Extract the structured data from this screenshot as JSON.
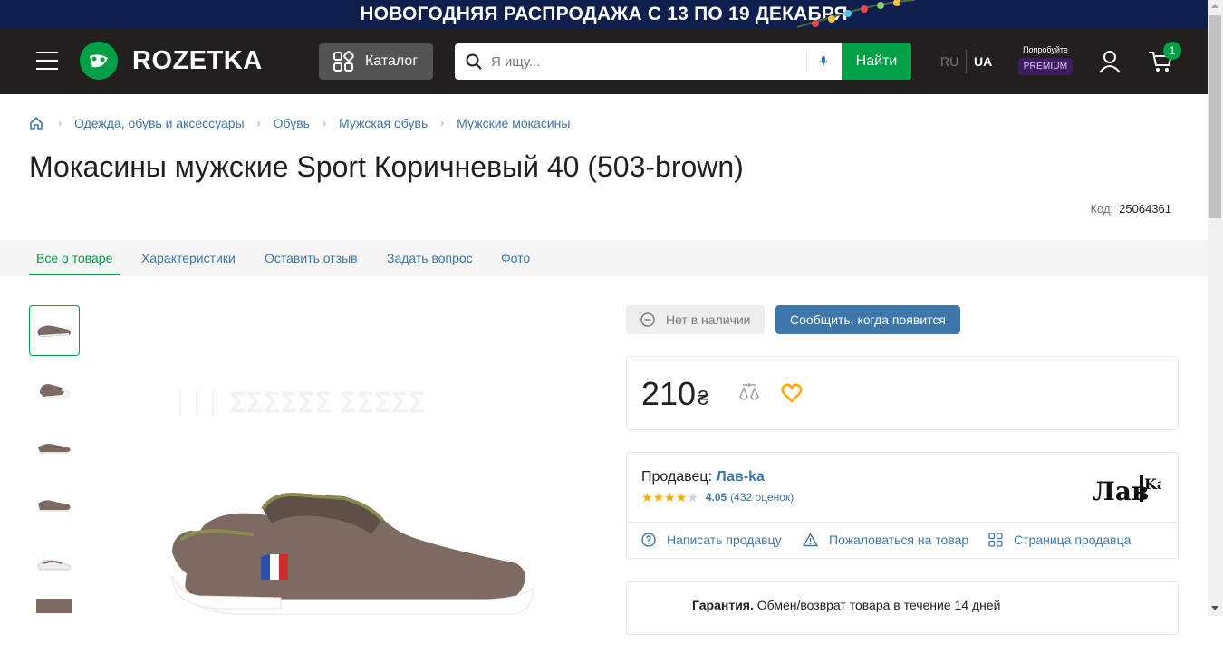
{
  "promo": {
    "text": "НОВОГОДНЯЯ РАСПРОДАЖА С 13 ПО 19 ДЕКАБРЯ"
  },
  "header": {
    "logo_text": "ROZETKA",
    "catalog_label": "Каталог",
    "search_placeholder": "Я ищу...",
    "search_button": "Найти",
    "lang_ru": "RU",
    "lang_ua": "UA",
    "premium_try": "Попробуйте",
    "premium_label": "PREMIUM",
    "cart_count": "1"
  },
  "breadcrumbs": [
    "Одежда, обувь и аксессуары",
    "Обувь",
    "Мужская обувь",
    "Мужские мокасины"
  ],
  "product": {
    "title": "Мокасины мужские Sport Коричневый 40 (503-brown)",
    "code_label": "Код:",
    "code_value": "25064361",
    "availability": "Нет в наличии",
    "notify_label": "Сообщить, когда появится",
    "price": "210",
    "currency": "₴"
  },
  "tabs": [
    "Все о товаре",
    "Характеристики",
    "Оставить отзыв",
    "Задать вопрос",
    "Фото"
  ],
  "seller": {
    "label": "Продавец:",
    "name": "Лав-ka",
    "rating": "4.05",
    "rating_count": "(432 оценок)",
    "stars": 4,
    "links": [
      "Написать продавцу",
      "Пожаловаться на товар",
      "Страница продавца"
    ]
  },
  "warranty": {
    "label": "Гарантия.",
    "text": "Обмен/возврат товара в течение 14 дней"
  },
  "colors": {
    "green": "#00a046",
    "blue_link": "#3e77aa",
    "dark": "#221f1f",
    "star": "#ffa900"
  }
}
